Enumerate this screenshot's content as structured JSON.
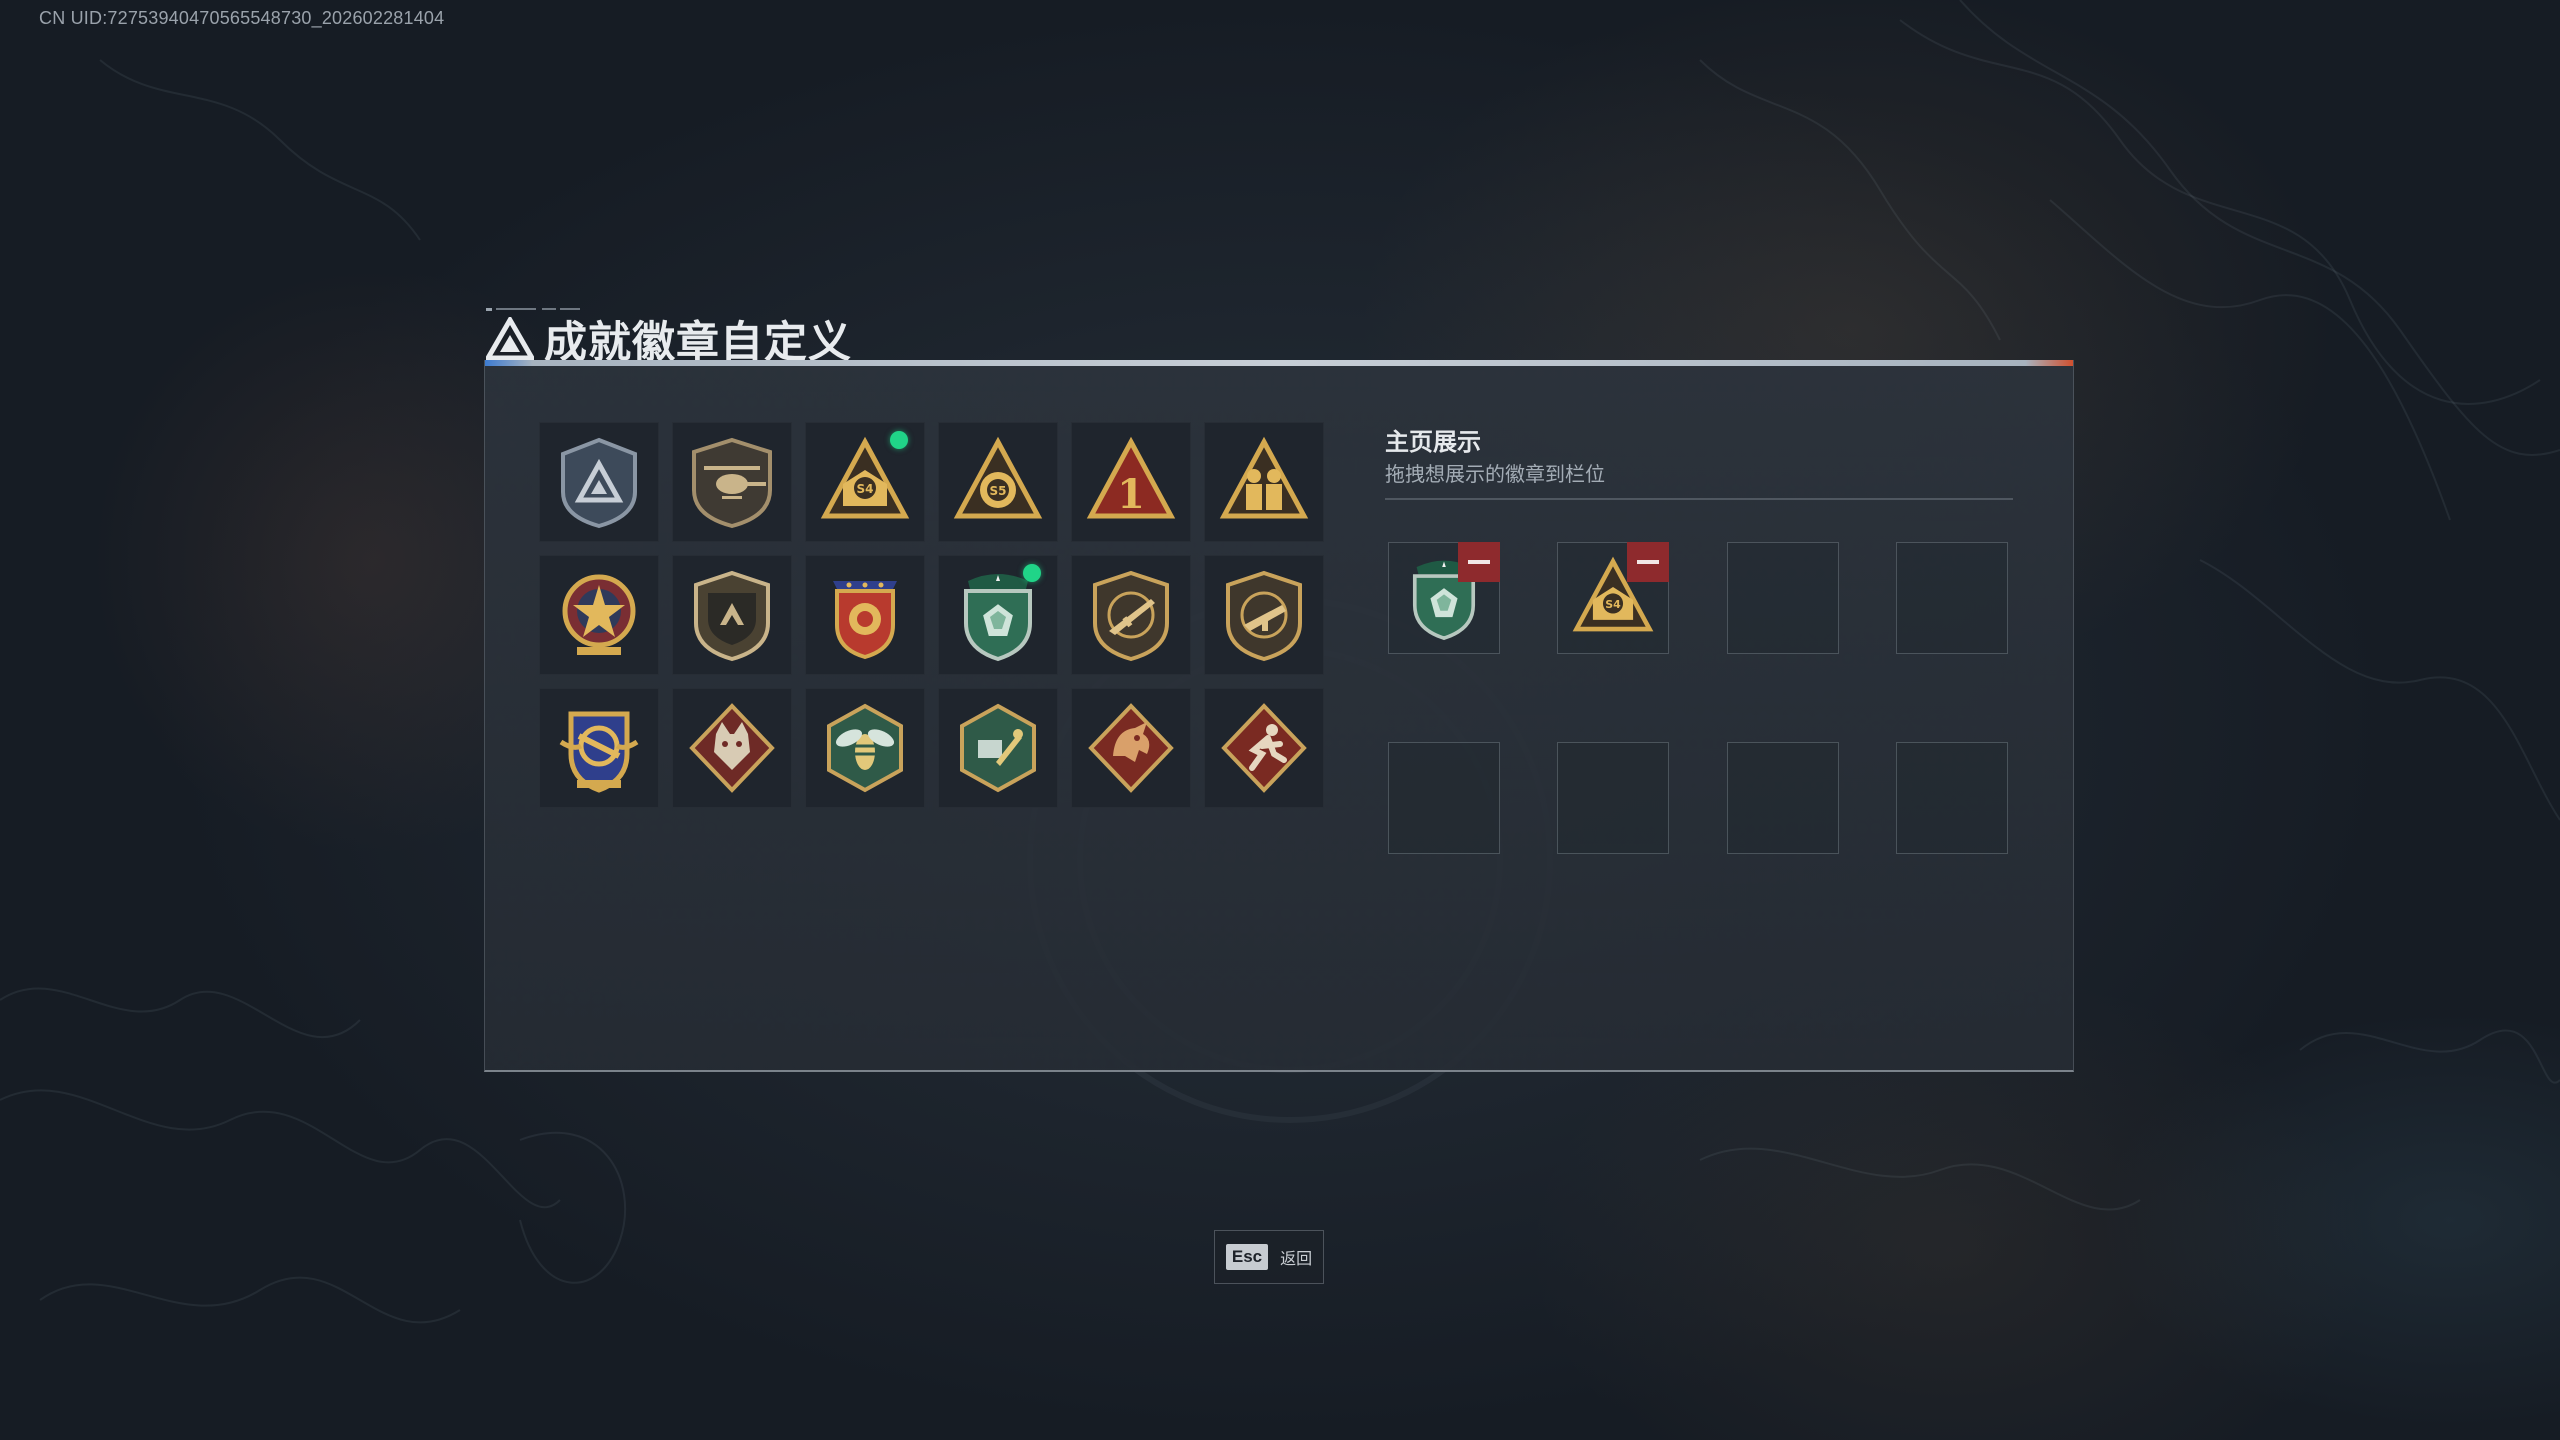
{
  "uid_text": "CN UID:7275394047056554873​0_202602281404",
  "title": "成就徽章自定义",
  "colors": {
    "accent_blue": "#3d7bd0",
    "accent_orange": "#d0502f",
    "new_dot": "#20d488",
    "remove_red": "#8e2a2d",
    "badge_gold": "#c9a35b",
    "badge_green": "#2f6e55"
  },
  "badges": [
    {
      "icon": "triangle-shield-badge-icon",
      "new": false
    },
    {
      "icon": "helicopter-shield-badge-icon",
      "new": false
    },
    {
      "icon": "s4-season-badge-icon",
      "new": true
    },
    {
      "icon": "s5-season-badge-icon",
      "new": false
    },
    {
      "icon": "number-one-badge-icon",
      "new": false
    },
    {
      "icon": "soldiers-triangle-badge-icon",
      "new": false
    },
    {
      "icon": "star-medal-badge-icon",
      "new": false
    },
    {
      "icon": "hand-shield-badge-icon",
      "new": false
    },
    {
      "icon": "stars-crest-badge-icon",
      "new": false
    },
    {
      "icon": "green-gem-shield-badge-icon",
      "new": true
    },
    {
      "icon": "rifle-shield-badge-icon",
      "new": false
    },
    {
      "icon": "smg-shield-badge-icon",
      "new": false
    },
    {
      "icon": "wings-crest-badge-icon",
      "new": false
    },
    {
      "icon": "wolf-diamond-badge-icon",
      "new": false
    },
    {
      "icon": "wasp-hexagon-badge-icon",
      "new": false
    },
    {
      "icon": "tools-hexagon-badge-icon",
      "new": false
    },
    {
      "icon": "dragon-diamond-badge-icon",
      "new": false
    },
    {
      "icon": "runner-diamond-badge-icon",
      "new": false
    }
  ],
  "showcase": {
    "title": "主页展示",
    "subtitle": "拖拽想展示的徽章到栏位",
    "slots": [
      {
        "badge": "green-gem-shield-badge-icon"
      },
      {
        "badge": "s4-season-badge-icon"
      },
      {
        "badge": null
      },
      {
        "badge": null
      },
      {
        "badge": null
      },
      {
        "badge": null
      },
      {
        "badge": null
      },
      {
        "badge": null
      }
    ]
  },
  "footer": {
    "esc_key": "Esc",
    "esc_label": "返回"
  }
}
